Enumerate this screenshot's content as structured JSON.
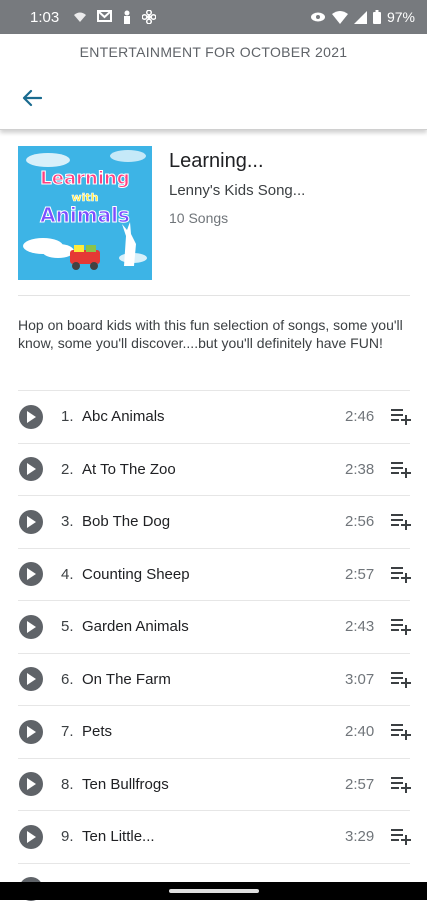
{
  "status_bar": {
    "time": "1:03",
    "battery": "97%",
    "icons": [
      "wifi-calling-icon",
      "gmail-icon",
      "person-icon",
      "fan-icon",
      "eye-icon",
      "wifi-icon",
      "signal-icon",
      "battery-icon"
    ]
  },
  "header": {
    "title": "ENTERTAINMENT FOR OCTOBER 2021",
    "back_icon": "arrow-back-icon"
  },
  "album": {
    "cover_text_line1": "Learning",
    "cover_text_line2": "with",
    "cover_text_line3": "Animals",
    "title": "Learning...",
    "artist": "Lenny's Kids Song...",
    "song_count": "10 Songs"
  },
  "description": "Hop on board kids with this fun selection of songs, some you'll know, some you'll discover....but you'll definitely have FUN!",
  "tracks": [
    {
      "num": "1.",
      "name": "Abc Animals",
      "duration": "2:46"
    },
    {
      "num": "2.",
      "name": "At To The Zoo",
      "duration": "2:38"
    },
    {
      "num": "3.",
      "name": "Bob The Dog",
      "duration": "2:56"
    },
    {
      "num": "4.",
      "name": "Counting Sheep",
      "duration": "2:57"
    },
    {
      "num": "5.",
      "name": "Garden Animals",
      "duration": "2:43"
    },
    {
      "num": "6.",
      "name": "On The Farm",
      "duration": "3:07"
    },
    {
      "num": "7.",
      "name": "Pets",
      "duration": "2:40"
    },
    {
      "num": "8.",
      "name": "Ten Bullfrogs",
      "duration": "2:57"
    },
    {
      "num": "9.",
      "name": "Ten Little...",
      "duration": "3:29"
    }
  ],
  "colors": {
    "status_bar": "#777a7e",
    "accent": "#1a6b8f",
    "play_button": "#5f6368",
    "cover_bg": "#3db4e6"
  }
}
